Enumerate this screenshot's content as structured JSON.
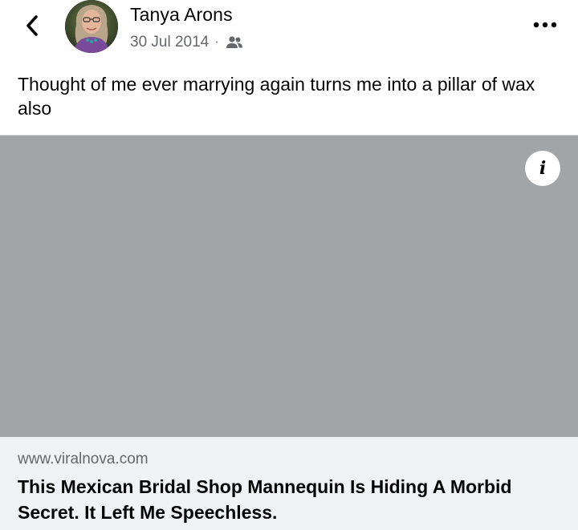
{
  "post": {
    "author": "Tanya Arons",
    "date": "30 Jul 2014",
    "separator": "·",
    "audience_icon": "friends-icon",
    "text": "Thought of me ever marrying again turns me into a pillar of wax also"
  },
  "link_preview": {
    "domain": "www.viralnova.com",
    "title": "This Mexican Bridal Shop Mannequin Is Hiding A Morbid Secret. It Left Me Speechless.",
    "info_label": "i",
    "image_placeholder_color": "#a2a5a8"
  },
  "icons": {
    "back": "chevron-left-icon",
    "more": "more-horizontal-icon",
    "info": "info-icon"
  },
  "colors": {
    "text_primary": "#050505",
    "text_secondary": "#65676b",
    "card_background": "#f0f2f5"
  }
}
